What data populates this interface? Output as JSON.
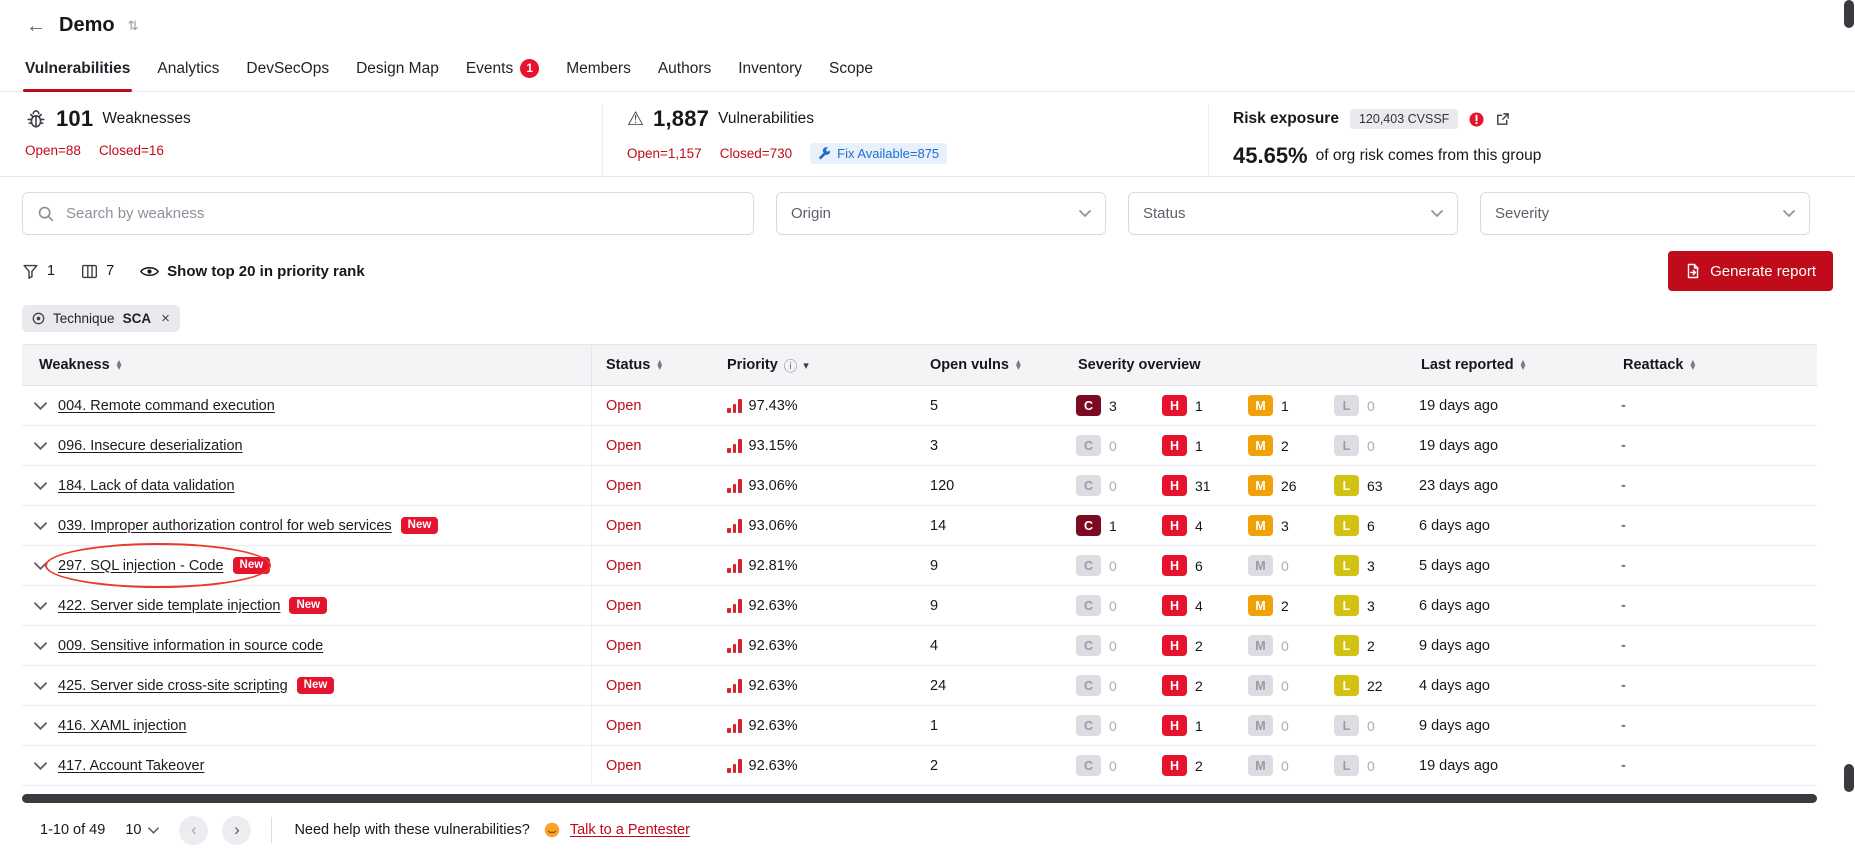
{
  "icons": {
    "back": "←",
    "title_sort": "⇅",
    "warning": "⚠",
    "info": "ⓘ",
    "close": "×",
    "sort_asc": "▴",
    "sort_desc": "▾",
    "page_prev": "‹",
    "page_next": "›"
  },
  "colors": {
    "accent": "#bf0b1a",
    "critical": "#7d0a23",
    "high": "#e5132e",
    "medium": "#f0a008",
    "low": "#d3c212",
    "fix_badge_text": "#1f6fd1"
  },
  "header": {
    "title": "Demo",
    "tabs": [
      {
        "label": "Vulnerabilities",
        "active": true
      },
      {
        "label": "Analytics"
      },
      {
        "label": "DevSecOps"
      },
      {
        "label": "Design Map"
      },
      {
        "label": "Events",
        "badge": "1"
      },
      {
        "label": "Members"
      },
      {
        "label": "Authors"
      },
      {
        "label": "Inventory"
      },
      {
        "label": "Scope"
      }
    ]
  },
  "summary": {
    "weaknesses": {
      "count": "101",
      "label": "Weaknesses",
      "open": "Open=88",
      "closed": "Closed=16"
    },
    "vulnerabilities": {
      "count": "1,887",
      "label": "Vulnerabilities",
      "open": "Open=1,157",
      "closed": "Closed=730",
      "fix_available": "Fix Available=875"
    },
    "risk": {
      "label": "Risk exposure",
      "badge": "120,403 CVSSF",
      "percent": "45.65%",
      "description": "of org risk comes from this group"
    }
  },
  "filters": {
    "search_placeholder": "Search by weakness",
    "dropdowns": [
      "Origin",
      "Status",
      "Severity"
    ]
  },
  "toolbar": {
    "filter_count": "1",
    "columns_count": "7",
    "top_rank_label": "Show top 20 in priority rank",
    "generate_report_label": "Generate report"
  },
  "active_filters": [
    {
      "category": "Technique",
      "value": "SCA"
    }
  ],
  "table": {
    "columns": [
      "Weakness",
      "Status",
      "Priority",
      "Open vulns",
      "Severity overview",
      "Last reported",
      "Reattack"
    ],
    "new_badge_label": "New",
    "severity_keys": [
      {
        "key": "c",
        "letter": "C"
      },
      {
        "key": "h",
        "letter": "H"
      },
      {
        "key": "m",
        "letter": "M"
      },
      {
        "key": "l",
        "letter": "L"
      }
    ],
    "rows": [
      {
        "weakness": "004. Remote command execution",
        "new": false,
        "status": "Open",
        "priority": "97.43%",
        "open_vulns": "5",
        "severity": {
          "c": 3,
          "h": 1,
          "m": 1,
          "l": 0
        },
        "last_reported": "19 days ago",
        "reattack": "-"
      },
      {
        "weakness": "096. Insecure deserialization",
        "new": false,
        "status": "Open",
        "priority": "93.15%",
        "open_vulns": "3",
        "severity": {
          "c": 0,
          "h": 1,
          "m": 2,
          "l": 0
        },
        "last_reported": "19 days ago",
        "reattack": "-"
      },
      {
        "weakness": "184. Lack of data validation",
        "new": false,
        "status": "Open",
        "priority": "93.06%",
        "open_vulns": "120",
        "severity": {
          "c": 0,
          "h": 31,
          "m": 26,
          "l": 63
        },
        "last_reported": "23 days ago",
        "reattack": "-"
      },
      {
        "weakness": "039. Improper authorization control for web services",
        "new": true,
        "status": "Open",
        "priority": "93.06%",
        "open_vulns": "14",
        "severity": {
          "c": 1,
          "h": 4,
          "m": 3,
          "l": 6
        },
        "last_reported": "6 days ago",
        "reattack": "-"
      },
      {
        "weakness": "297. SQL injection - Code",
        "new": true,
        "status": "Open",
        "priority": "92.81%",
        "open_vulns": "9",
        "severity": {
          "c": 0,
          "h": 6,
          "m": 0,
          "l": 3
        },
        "last_reported": "5 days ago",
        "reattack": "-"
      },
      {
        "weakness": "422. Server side template injection",
        "new": true,
        "status": "Open",
        "priority": "92.63%",
        "open_vulns": "9",
        "severity": {
          "c": 0,
          "h": 4,
          "m": 2,
          "l": 3
        },
        "last_reported": "6 days ago",
        "reattack": "-"
      },
      {
        "weakness": "009. Sensitive information in source code",
        "new": false,
        "status": "Open",
        "priority": "92.63%",
        "open_vulns": "4",
        "severity": {
          "c": 0,
          "h": 2,
          "m": 0,
          "l": 2
        },
        "last_reported": "9 days ago",
        "reattack": "-"
      },
      {
        "weakness": "425. Server side cross-site scripting",
        "new": true,
        "status": "Open",
        "priority": "92.63%",
        "open_vulns": "24",
        "severity": {
          "c": 0,
          "h": 2,
          "m": 0,
          "l": 22
        },
        "last_reported": "4 days ago",
        "reattack": "-"
      },
      {
        "weakness": "416. XAML injection",
        "new": false,
        "status": "Open",
        "priority": "92.63%",
        "open_vulns": "1",
        "severity": {
          "c": 0,
          "h": 1,
          "m": 0,
          "l": 0
        },
        "last_reported": "9 days ago",
        "reattack": "-"
      },
      {
        "weakness": "417. Account Takeover",
        "new": false,
        "status": "Open",
        "priority": "92.63%",
        "open_vulns": "2",
        "severity": {
          "c": 0,
          "h": 2,
          "m": 0,
          "l": 0
        },
        "last_reported": "19 days ago",
        "reattack": "-"
      }
    ]
  },
  "footer": {
    "range": "1-10 of 49",
    "page_size": "10",
    "help_text": "Need help with these vulnerabilities?",
    "cta_label": "Talk to a Pentester"
  }
}
